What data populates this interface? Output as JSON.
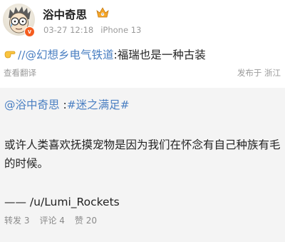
{
  "author": {
    "name": "浴中奇思",
    "verified_badge": "v",
    "timestamp": "03-27 12:18",
    "device": "iPhone 13"
  },
  "post": {
    "emoji": "pointing-hand-icon",
    "prefix": "//",
    "mention": "@幻想乡电气铁道",
    "text": ":福瑞也是一种古装",
    "translate_label": "查看翻译",
    "location_label": "发布于 浙江"
  },
  "repost": {
    "mention": "@浴中奇思",
    "separator": ":",
    "hashtag": "#迷之满足#",
    "text": "或许人类喜欢抚摸宠物是因为我们在怀念有自己种族有毛的时候。",
    "signature": "—— /u/Lumi_Rockets",
    "stats": {
      "reposts": "转发 3",
      "comments": "评论 4",
      "likes": "赞 20"
    }
  },
  "colors": {
    "link": "#4a7fc2",
    "meta": "#9a9a9a",
    "repost_bg": "#f4f4f4",
    "badge_orange": "#f55c1e"
  }
}
